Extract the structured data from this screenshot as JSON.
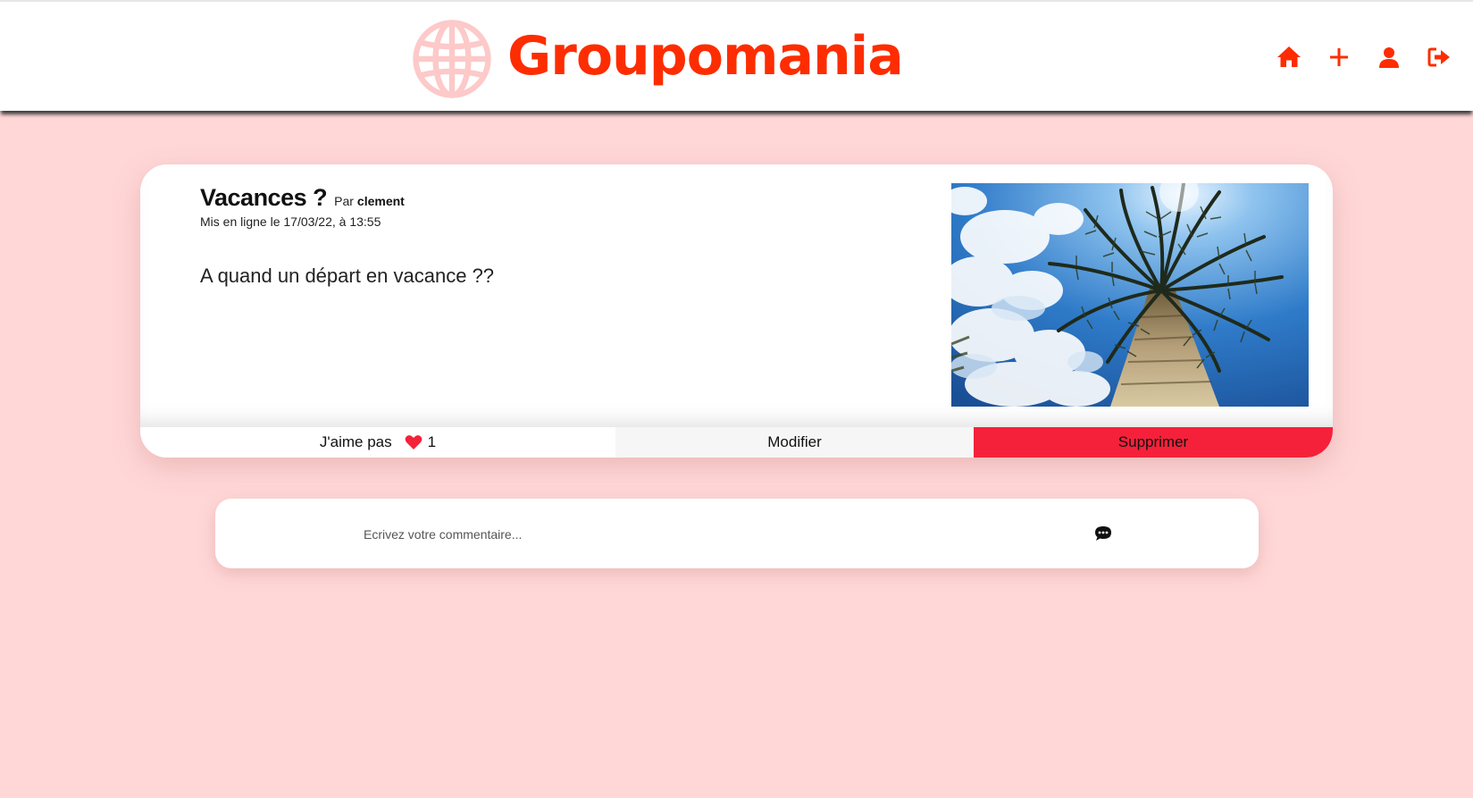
{
  "header": {
    "brand": "Groupomania",
    "brand_color": "#fd2d01",
    "logo_icon": "globe-icon",
    "nav": [
      {
        "icon": "home-icon"
      },
      {
        "icon": "plus-icon"
      },
      {
        "icon": "user-icon"
      },
      {
        "icon": "logout-icon"
      }
    ]
  },
  "post": {
    "title": "Vacances ?",
    "by_label": "Par",
    "author": "clement",
    "date": "Mis en ligne le 17/03/22, à 13:55",
    "content": "A quand un départ en vacance ??",
    "image": "palm-tree-photo",
    "like_label": "J'aime pas",
    "like_icon": "heart-icon",
    "like_count": "1",
    "edit_label": "Modifier",
    "delete_label": "Supprimer",
    "delete_color": "#f5213a"
  },
  "comment": {
    "placeholder": "Ecrivez votre commentaire...",
    "send_icon": "comment-icon"
  },
  "colors": {
    "background": "#ffd7d7",
    "accent": "#fd2d01"
  }
}
